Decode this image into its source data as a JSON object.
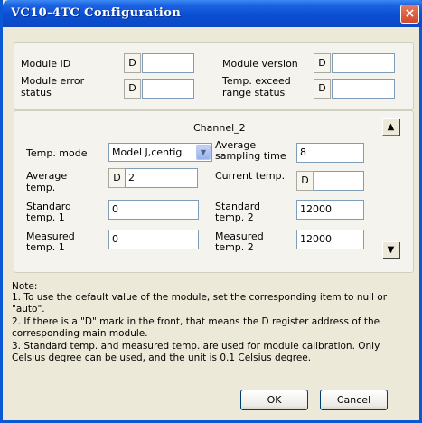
{
  "window": {
    "title": "VC10-4TC Configuration"
  },
  "module": {
    "id_label": "Module ID",
    "id_prefix": "D",
    "id_value": "",
    "version_label": "Module version",
    "version_prefix": "D",
    "version_value": "",
    "error_label_1": "Module error",
    "error_label_2": "status",
    "error_prefix": "D",
    "error_value": "",
    "exceed_label_1": "Temp. exceed",
    "exceed_label_2": "range status",
    "exceed_prefix": "D",
    "exceed_value": ""
  },
  "channel": {
    "title": "Channel_2",
    "temp_mode_label": "Temp. mode",
    "temp_mode_value": "Model J,centig",
    "avg_sampling_label_1": "Average",
    "avg_sampling_label_2": "sampling time",
    "avg_sampling_value": "8",
    "avg_temp_label_1": "Average",
    "avg_temp_label_2": "temp.",
    "avg_temp_prefix": "D",
    "avg_temp_value": "2",
    "current_temp_label": "Current temp.",
    "current_temp_prefix": "D",
    "current_temp_value": "",
    "std1_label_1": "Standard",
    "std1_label_2": "temp. 1",
    "std1_value": "0",
    "std2_label_1": "Standard",
    "std2_label_2": "temp. 2",
    "std2_value": "12000",
    "meas1_label_1": "Measured",
    "meas1_label_2": "temp. 1",
    "meas1_value": "0",
    "meas2_label_1": "Measured",
    "meas2_label_2": "temp. 2",
    "meas2_value": "12000"
  },
  "notes": {
    "heading": "Note:",
    "line1": "1. To use the default value of the module, set the corresponding item to null or",
    "line2": "\"auto\".",
    "line3": "2. If there is a \"D\" mark in the front, that means the D register address of the",
    "line4": "corresponding main module.",
    "line5": "3. Standard temp. and measured temp. are used for module calibration. Only",
    "line6": "Celsius degree can be used, and the unit is 0.1 Celsius degree."
  },
  "buttons": {
    "ok": "OK",
    "cancel": "Cancel"
  },
  "icons": {
    "close": "×",
    "up": "▲",
    "down": "▼",
    "dropdown": "▼"
  }
}
